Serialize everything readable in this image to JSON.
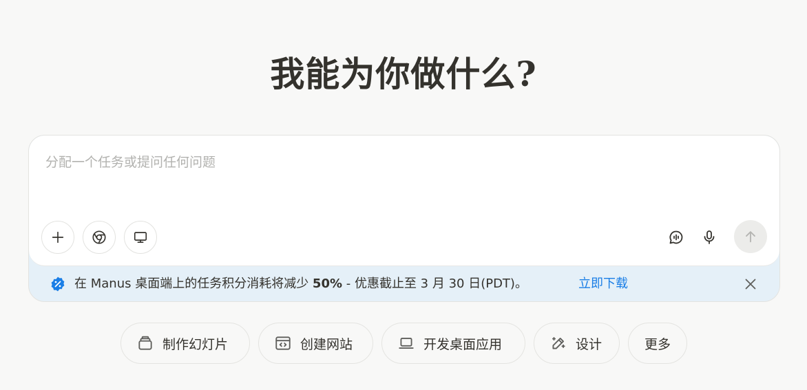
{
  "headline": "我能为你做什么?",
  "composer": {
    "placeholder": "分配一个任务或提问任何问题",
    "value": "",
    "tools": [
      {
        "icon": "plus-icon"
      },
      {
        "icon": "chrome-icon"
      },
      {
        "icon": "monitor-icon"
      }
    ],
    "right_tools": [
      {
        "icon": "voice-chat-icon"
      },
      {
        "icon": "microphone-icon"
      },
      {
        "icon": "arrow-up-icon"
      }
    ]
  },
  "promo": {
    "badge_icon": "discount-badge-icon",
    "text_before": "在 Manus 桌面端上的任务积分消耗将减少 ",
    "text_bold": "50%",
    "text_after": " - 优惠截止至 3 月 30 日(PDT)。",
    "link": "立即下载",
    "link_color": "#1a7ee6",
    "close_icon": "close-icon"
  },
  "quick_actions": [
    {
      "label": "制作幻灯片",
      "icon": "slides-icon"
    },
    {
      "label": "创建网站",
      "icon": "code-window-icon"
    },
    {
      "label": "开发桌面应用",
      "icon": "laptop-icon"
    },
    {
      "label": "设计",
      "icon": "magic-pen-icon"
    },
    {
      "label": "更多",
      "icon": ""
    }
  ]
}
